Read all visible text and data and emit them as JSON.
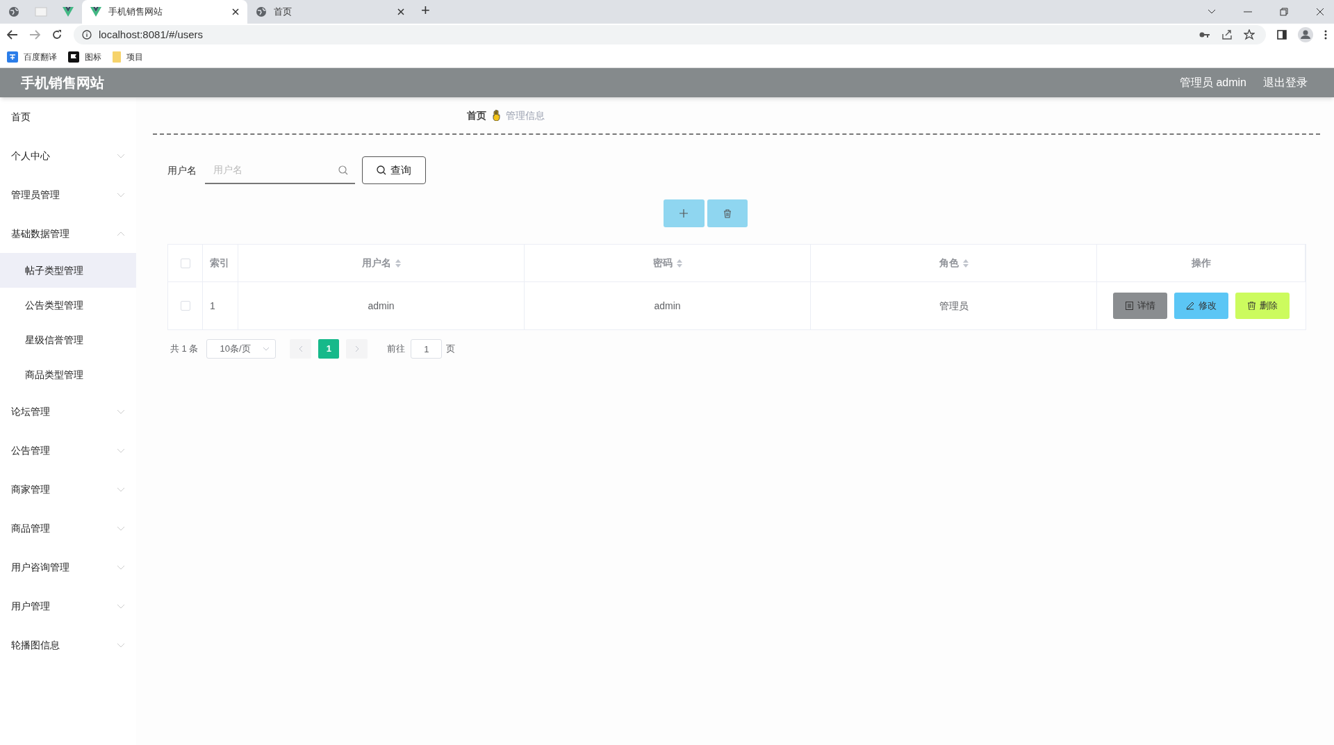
{
  "browser": {
    "tabs": [
      {
        "title": "手机销售网站",
        "selected": true
      },
      {
        "title": "首页",
        "selected": false
      }
    ],
    "url": "localhost:8081/#/users",
    "new_tab": "+",
    "bookmarks": [
      "百度翻译",
      "图标",
      "项目"
    ]
  },
  "app": {
    "title": "手机销售网站",
    "user": "管理员 admin",
    "logout": "退出登录"
  },
  "sidebar": {
    "items": [
      {
        "label": "首页",
        "kind": "link"
      },
      {
        "label": "个人中心",
        "kind": "menu",
        "expanded": false
      },
      {
        "label": "管理员管理",
        "kind": "menu",
        "expanded": false
      },
      {
        "label": "基础数据管理",
        "kind": "menu",
        "expanded": true,
        "children": [
          {
            "label": "帖子类型管理",
            "selected": true
          },
          {
            "label": "公告类型管理",
            "selected": false
          },
          {
            "label": "星级信誉管理",
            "selected": false
          },
          {
            "label": "商品类型管理",
            "selected": false
          }
        ]
      },
      {
        "label": "论坛管理",
        "kind": "menu",
        "expanded": false
      },
      {
        "label": "公告管理",
        "kind": "menu",
        "expanded": false
      },
      {
        "label": "商家管理",
        "kind": "menu",
        "expanded": false
      },
      {
        "label": "商品管理",
        "kind": "menu",
        "expanded": false
      },
      {
        "label": "用户咨询管理",
        "kind": "menu",
        "expanded": false
      },
      {
        "label": "用户管理",
        "kind": "menu",
        "expanded": false
      },
      {
        "label": "轮播图信息",
        "kind": "menu",
        "expanded": false
      }
    ]
  },
  "breadcrumb": [
    "首页",
    "管理信息"
  ],
  "search": {
    "label": "用户名",
    "placeholder": "用户名",
    "button": "查询"
  },
  "table": {
    "all_checked": false,
    "columns": [
      {
        "label": "索引",
        "sortable": false
      },
      {
        "label": "用户名",
        "sortable": true
      },
      {
        "label": "密码",
        "sortable": true
      },
      {
        "label": "角色",
        "sortable": true
      },
      {
        "label": "操作",
        "sortable": false
      }
    ],
    "rows": [
      {
        "checked": false,
        "cells": [
          "1",
          "admin",
          "admin",
          "管理员"
        ]
      }
    ],
    "actions": [
      {
        "label": "详情",
        "kind": "detail"
      },
      {
        "label": "修改",
        "kind": "edit"
      },
      {
        "label": "删除",
        "kind": "delete"
      }
    ]
  },
  "pagination": {
    "total": "共 1 条",
    "page_size": "10条/页",
    "pages": [
      {
        "label": "1",
        "selected": true
      }
    ],
    "goto": "前往",
    "goto_value": "1",
    "suffix": "页"
  }
}
